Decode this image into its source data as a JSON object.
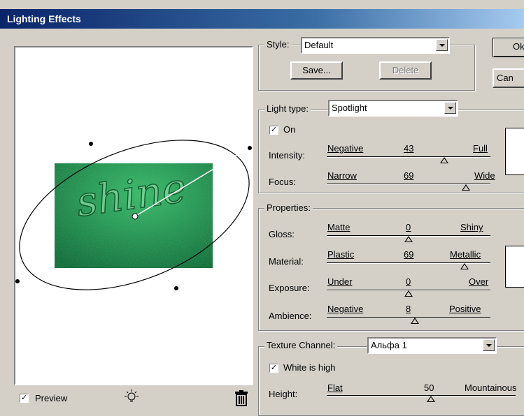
{
  "window": {
    "title": "Lighting Effects"
  },
  "buttons": {
    "ok": "Ok",
    "cancel": "Can",
    "save": "Save...",
    "delete": "Delete"
  },
  "style": {
    "label": "Style:",
    "value": "Default"
  },
  "light": {
    "label": "Light type:",
    "value": "Spotlight",
    "on_label": "On",
    "on_checked": true,
    "intensity": {
      "label": "Intensity:",
      "min": "Negative",
      "max": "Full",
      "value": "43",
      "fraction": 0.72
    },
    "focus": {
      "label": "Focus:",
      "min": "Narrow",
      "max": "Wide",
      "value": "69",
      "fraction": 0.85
    }
  },
  "properties": {
    "label": "Properties:",
    "gloss": {
      "label": "Gloss:",
      "min": "Matte",
      "max": "Shiny",
      "value": "0",
      "fraction": 0.5
    },
    "material": {
      "label": "Material:",
      "min": "Plastic",
      "max": "Metallic",
      "value": "69",
      "fraction": 0.84
    },
    "exposure": {
      "label": "Exposure:",
      "min": "Under",
      "max": "Over",
      "value": "0",
      "fraction": 0.5
    },
    "ambience": {
      "label": "Ambience:",
      "min": "Negative",
      "max": "Positive",
      "value": "8",
      "fraction": 0.54
    }
  },
  "texture": {
    "label": "Texture Channel:",
    "value": "Альфа 1",
    "white_high_label": "White is high",
    "white_high_checked": true,
    "height": {
      "label": "Height:",
      "min": "Flat",
      "max": "Mountainous",
      "value": "50",
      "fraction": 0.55
    }
  },
  "preview": {
    "label": "Preview",
    "checked": true,
    "sample_text": "shine"
  },
  "icons": {
    "new_light": "lightbulb-icon",
    "delete_light": "trash-icon"
  },
  "colors": {
    "title_bar_start": "#0a246a",
    "title_bar_end": "#a6caf0",
    "dialog_face": "#d4d0c8",
    "texture_green": "#1f8a4a"
  }
}
